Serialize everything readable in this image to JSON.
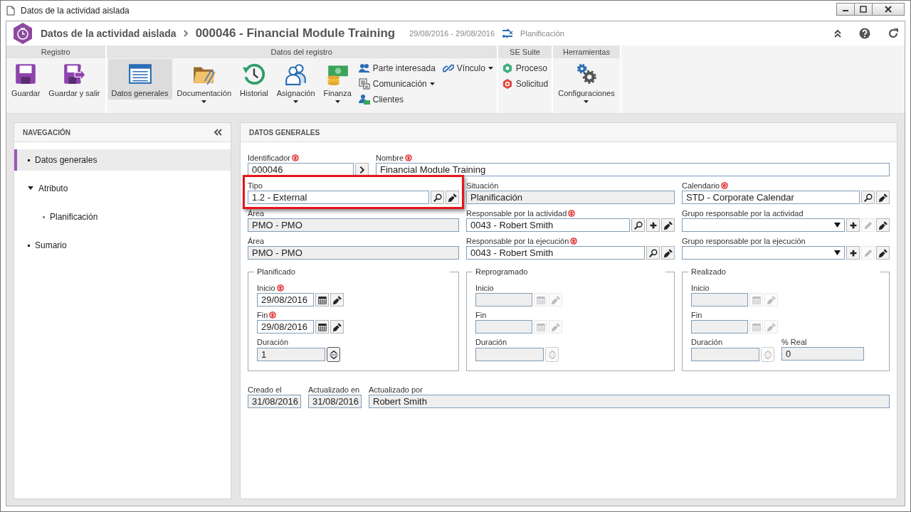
{
  "window": {
    "title": "Datos de la actividad aislada"
  },
  "header": {
    "parent": "Datos de la actividad aislada",
    "title": "000046 - Financial Module Training",
    "dates": "29/08/2016 - 29/08/2016",
    "status": "Planificación"
  },
  "ribbon": [
    {
      "label": "Registro",
      "items": [
        {
          "kind": "large",
          "label": "Guardar",
          "selected": false,
          "dropdown": false
        },
        {
          "kind": "large",
          "label": "Guardar y salir",
          "selected": false,
          "dropdown": false
        }
      ]
    },
    {
      "label": "Datos del registro",
      "items": [
        {
          "kind": "large",
          "label": "Datos generales",
          "selected": true,
          "dropdown": false
        },
        {
          "kind": "large",
          "label": "Documentación",
          "selected": false,
          "dropdown": true
        },
        {
          "kind": "large",
          "label": "Historial",
          "selected": false,
          "dropdown": false
        },
        {
          "kind": "large",
          "label": "Asignación",
          "selected": false,
          "dropdown": true
        },
        {
          "kind": "large",
          "label": "Finanza",
          "selected": false,
          "dropdown": true
        },
        {
          "kind": "small",
          "label": "Parte interesada",
          "selected": false,
          "dropdown": false
        },
        {
          "kind": "small",
          "label": "Comunicación",
          "selected": false,
          "dropdown": true
        },
        {
          "kind": "small",
          "label": "Clientes",
          "selected": false,
          "dropdown": false
        },
        {
          "kind": "small",
          "label": "Vínculo",
          "selected": false,
          "dropdown": true
        }
      ]
    },
    {
      "label": "SE Suite",
      "items": [
        {
          "kind": "small",
          "label": "Proceso",
          "selected": false,
          "dropdown": false
        },
        {
          "kind": "small",
          "label": "Solicitud",
          "selected": false,
          "dropdown": false
        }
      ]
    },
    {
      "label": "Herramientas",
      "items": [
        {
          "kind": "large",
          "label": "Configuraciones",
          "selected": false,
          "dropdown": true
        }
      ]
    }
  ],
  "navigation": {
    "title": "NAVEGACIÓN",
    "items": [
      {
        "label": "Datos generales",
        "selected": true
      },
      {
        "label": "Atributo",
        "selected": false,
        "expanded": true,
        "children": [
          {
            "label": "Planificación",
            "selected": false
          }
        ]
      },
      {
        "label": "Sumario",
        "selected": false
      }
    ]
  },
  "panel": {
    "title": "DATOS GENERALES",
    "top": [
      {
        "kind": "id",
        "label": "Identificador",
        "value": "000046",
        "required": true,
        "readonly": false,
        "buttons": [
          {
            "kind": "next",
            "disabled": false
          }
        ]
      },
      {
        "kind": "text",
        "label": "Nombre",
        "value": "Financial Module Training",
        "required": true,
        "readonly": false
      }
    ],
    "grid": [
      {
        "kind": "text",
        "label": "Tipo",
        "value": "1.2 - External",
        "required": false,
        "readonly": false,
        "highlighted": true,
        "buttons": [
          {
            "kind": "search",
            "disabled": false
          },
          {
            "kind": "clear",
            "disabled": false
          }
        ]
      },
      {
        "kind": "text",
        "label": "Situación",
        "value": "Planificación",
        "required": false,
        "readonly": true,
        "highlighted": false
      },
      {
        "kind": "text",
        "label": "Calendario",
        "value": "STD - Corporate Calendar",
        "required": true,
        "readonly": false,
        "highlighted": false,
        "buttons": [
          {
            "kind": "search",
            "disabled": false
          },
          {
            "kind": "clear",
            "disabled": false
          }
        ]
      },
      {
        "kind": "text",
        "label": "Área",
        "value": "PMO - PMO",
        "required": false,
        "readonly": true,
        "highlighted": false
      },
      {
        "kind": "text",
        "label": "Responsable por la actividad",
        "value": "0043 - Robert Smith",
        "required": true,
        "readonly": false,
        "highlighted": false,
        "buttons": [
          {
            "kind": "search",
            "disabled": false
          },
          {
            "kind": "add",
            "disabled": false
          },
          {
            "kind": "clear",
            "disabled": false
          }
        ]
      },
      {
        "kind": "select",
        "label": "Grupo responsable por la actividad",
        "required": false,
        "readonly": false,
        "highlighted": false,
        "buttons": [
          {
            "kind": "add",
            "disabled": false
          },
          {
            "kind": "edit",
            "disabled": true
          },
          {
            "kind": "clear",
            "disabled": false
          }
        ]
      },
      {
        "kind": "text",
        "label": "Área",
        "value": "PMO - PMO",
        "required": false,
        "readonly": true,
        "highlighted": false
      },
      {
        "kind": "text",
        "label": "Responsable por la ejecución",
        "value": "0043 - Robert Smith",
        "required": true,
        "readonly": false,
        "highlighted": false,
        "buttons": [
          {
            "kind": "search",
            "disabled": false
          },
          {
            "kind": "clear",
            "disabled": false
          }
        ]
      },
      {
        "kind": "select",
        "label": "Grupo responsable por la ejecución",
        "required": false,
        "readonly": false,
        "highlighted": false,
        "buttons": [
          {
            "kind": "add",
            "disabled": false
          },
          {
            "kind": "edit",
            "disabled": true
          },
          {
            "kind": "clear",
            "disabled": false
          }
        ]
      }
    ],
    "groups": [
      {
        "title": "Planificado",
        "fields": [
          {
            "kind": "date",
            "label": "Inicio",
            "value": "29/08/2016",
            "required": true,
            "readonly": false,
            "buttons": [
              {
                "kind": "calendar",
                "disabled": false
              },
              {
                "kind": "clear",
                "disabled": false
              }
            ]
          },
          {
            "kind": "date",
            "label": "Fin",
            "value": "29/08/2016",
            "required": true,
            "readonly": false,
            "buttons": [
              {
                "kind": "calendar",
                "disabled": false
              },
              {
                "kind": "clear",
                "disabled": false
              }
            ]
          },
          {
            "kind": "number",
            "label": "Duración",
            "value": "1",
            "required": false,
            "readonly": true,
            "buttons": [
              {
                "kind": "spin",
                "disabled": false
              }
            ]
          }
        ]
      },
      {
        "title": "Reprogramado",
        "fields": [
          {
            "kind": "date",
            "label": "Inicio",
            "required": false,
            "readonly": true,
            "buttons": [
              {
                "kind": "calendar",
                "disabled": true
              },
              {
                "kind": "clear",
                "disabled": true
              }
            ]
          },
          {
            "kind": "date",
            "label": "Fin",
            "required": false,
            "readonly": true,
            "buttons": [
              {
                "kind": "calendar",
                "disabled": true
              },
              {
                "kind": "clear",
                "disabled": true
              }
            ]
          },
          {
            "kind": "number",
            "label": "Duración",
            "required": false,
            "readonly": true,
            "buttons": [
              {
                "kind": "spin",
                "disabled": true
              }
            ]
          }
        ]
      },
      {
        "title": "Realizado",
        "fields": [
          {
            "kind": "date",
            "label": "Inicio",
            "required": false,
            "readonly": true,
            "buttons": [
              {
                "kind": "calendar",
                "disabled": true
              },
              {
                "kind": "clear",
                "disabled": true
              }
            ]
          },
          {
            "kind": "date",
            "label": "Fin",
            "required": false,
            "readonly": true,
            "buttons": [
              {
                "kind": "calendar",
                "disabled": true
              },
              {
                "kind": "clear",
                "disabled": true
              }
            ]
          },
          {
            "kind": "number",
            "label": "Duración",
            "required": false,
            "readonly": true,
            "buttons": [
              {
                "kind": "spin",
                "disabled": true
              }
            ]
          },
          {
            "kind": "percent",
            "label": "% Real",
            "value": "0",
            "required": false,
            "readonly": true
          }
        ]
      }
    ],
    "footer": [
      {
        "kind": "stamp",
        "label": "Creado el",
        "value": "31/08/2016",
        "required": false,
        "readonly": true
      },
      {
        "kind": "stamp",
        "label": "Actualizado en",
        "value": "31/08/2016",
        "required": false,
        "readonly": true
      },
      {
        "kind": "text",
        "label": "Actualizado por",
        "value": "Robert Smith",
        "required": false,
        "readonly": true
      }
    ]
  }
}
